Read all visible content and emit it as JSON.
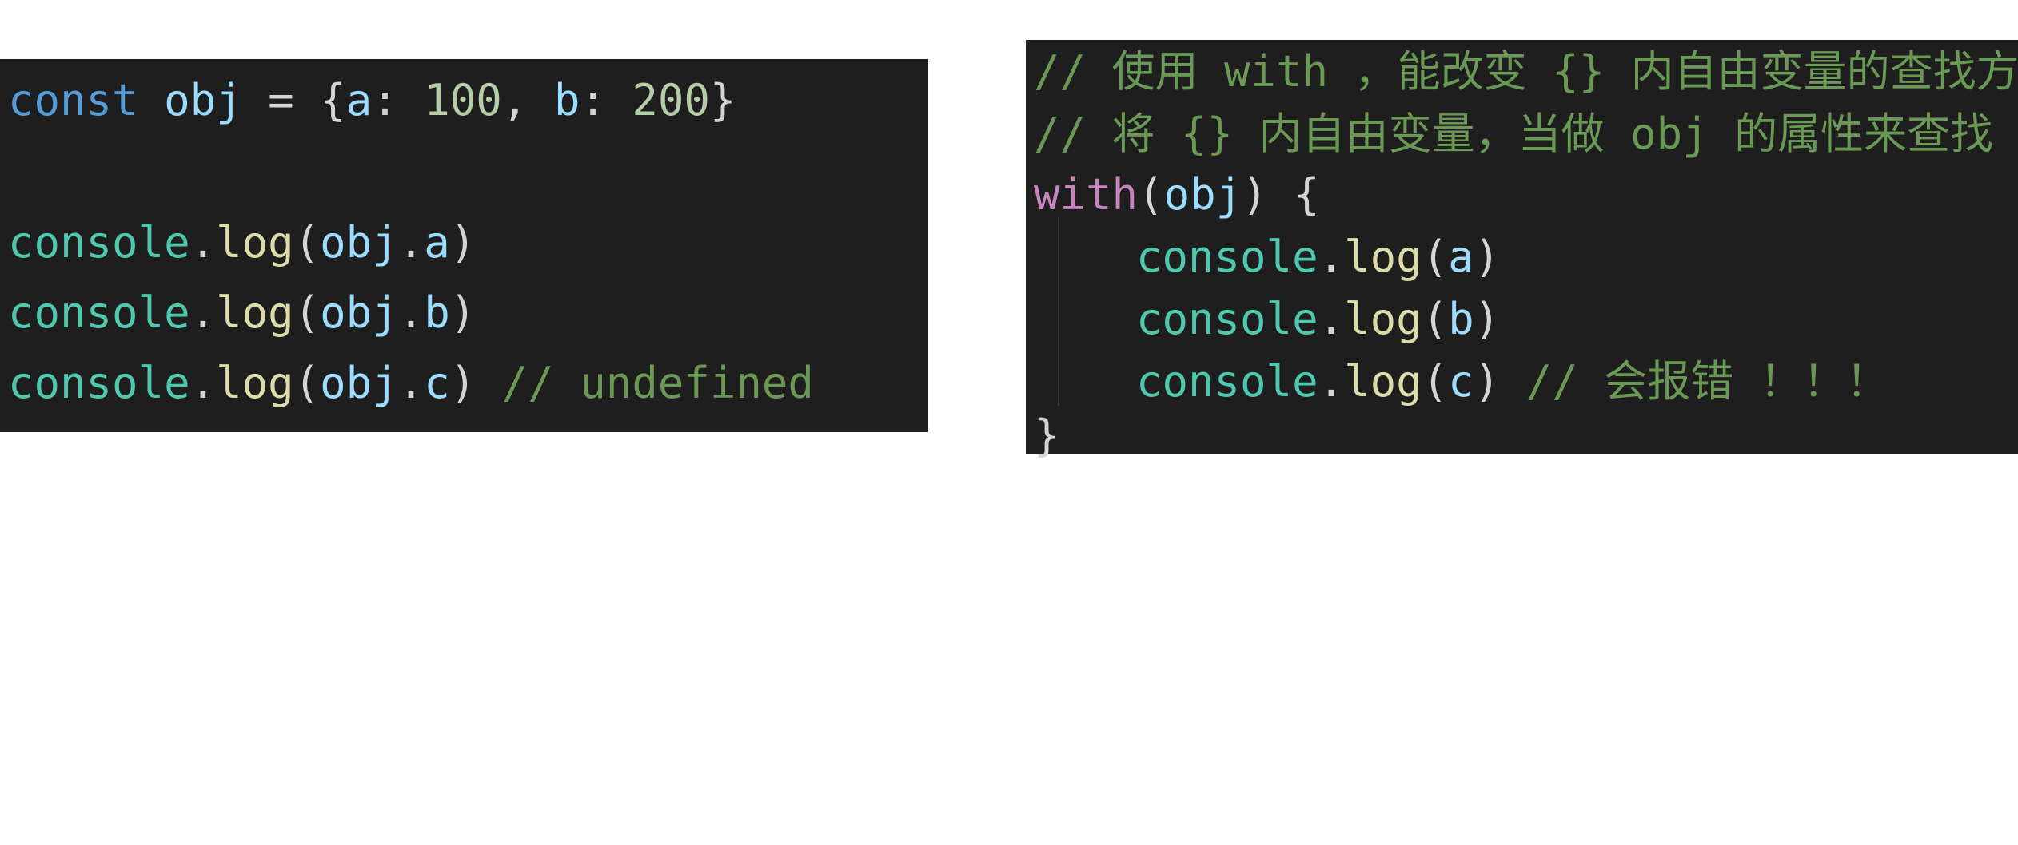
{
  "left_snippet": {
    "line1": {
      "kw": "const",
      "name": "obj",
      "eq": "=",
      "open": "{",
      "key_a": "a",
      "colon_a": ":",
      "val_a": "100",
      "comma": ",",
      "key_b": "b",
      "colon_b": ":",
      "val_b": "200",
      "close": "}"
    },
    "lines": [
      {
        "obj": "console",
        "dot": ".",
        "fn": "log",
        "open": "(",
        "arg_obj": "obj",
        "arg_dot": ".",
        "prop": "a",
        "close": ")",
        "comment": ""
      },
      {
        "obj": "console",
        "dot": ".",
        "fn": "log",
        "open": "(",
        "arg_obj": "obj",
        "arg_dot": ".",
        "prop": "b",
        "close": ")",
        "comment": ""
      },
      {
        "obj": "console",
        "dot": ".",
        "fn": "log",
        "open": "(",
        "arg_obj": "obj",
        "arg_dot": ".",
        "prop": "c",
        "close": ")",
        "comment": "// undefined"
      }
    ]
  },
  "right_snippet": {
    "comment1": "// 使用 with ，能改变 {} 内自由变量的查找方式",
    "comment2": "// 将 {} 内自由变量，当做 obj 的属性来查找",
    "with_line": {
      "kw": "with",
      "open": "(",
      "arg": "obj",
      "close": ")",
      "brace": "{"
    },
    "lines": [
      {
        "obj": "console",
        "dot": ".",
        "fn": "log",
        "open": "(",
        "arg": "a",
        "close": ")",
        "comment": ""
      },
      {
        "obj": "console",
        "dot": ".",
        "fn": "log",
        "open": "(",
        "arg": "b",
        "close": ")",
        "comment": ""
      },
      {
        "obj": "console",
        "dot": ".",
        "fn": "log",
        "open": "(",
        "arg": "c",
        "close": ")",
        "comment": "// 会报错 ！！！"
      }
    ],
    "closing_brace": "}"
  },
  "colors": {
    "background": "#1e1e1e",
    "keyword_blue": "#569cd6",
    "keyword_purple": "#c586c0",
    "variable": "#9cdcfe",
    "number": "#b5cea8",
    "function": "#dcdcaa",
    "class": "#4ec9b0",
    "comment": "#6a9955"
  }
}
